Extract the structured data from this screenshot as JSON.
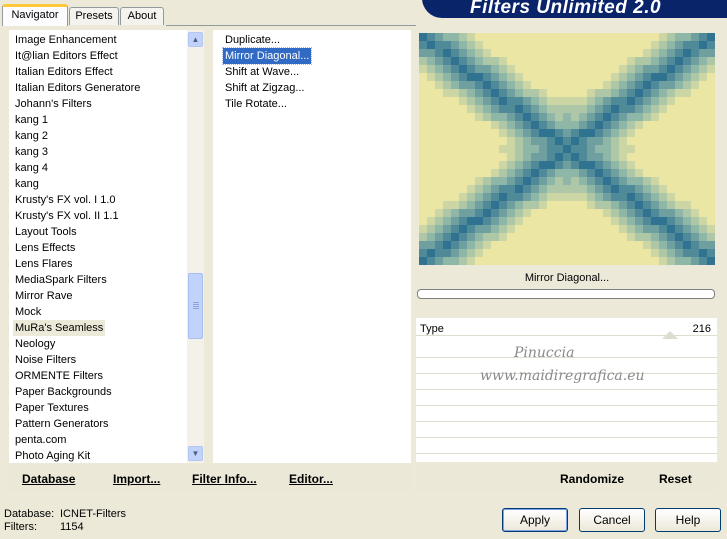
{
  "tabs": [
    {
      "label": "Navigator",
      "active": true
    },
    {
      "label": "Presets",
      "active": false
    },
    {
      "label": "About",
      "active": false
    }
  ],
  "app_title": "Filters Unlimited 2.0",
  "categories": [
    "Image Enhancement",
    "It@lian Editors Effect",
    "Italian Editors Effect",
    "Italian Editors Generatore",
    "Johann's Filters",
    "kang 1",
    "kang 2",
    "kang 3",
    "kang 4",
    "kang",
    "Krusty's FX vol. I 1.0",
    "Krusty's FX vol. II 1.1",
    "Layout Tools",
    "Lens Effects",
    "Lens Flares",
    "MediaSpark Filters",
    "Mirror Rave",
    "Mock",
    "MuRa's Seamless",
    "Neology",
    "Noise Filters",
    "ORMENTE Filters",
    "Paper Backgrounds",
    "Paper Textures",
    "Pattern Generators",
    "penta.com",
    "Photo Aging Kit"
  ],
  "selected_category": "MuRa's Seamless",
  "filters": [
    "Duplicate...",
    "Mirror Diagonal...",
    "Shift at Wave...",
    "Shift at Zigzag...",
    "Tile Rotate..."
  ],
  "selected_filter": "Mirror Diagonal...",
  "preview": {
    "filter_name": "Mirror Diagonal...",
    "colors": {
      "light": "#ebe6a4",
      "mid": "#8fb7a7",
      "dark": "#2f7390"
    }
  },
  "params": [
    {
      "label": "Type",
      "value": "216"
    }
  ],
  "watermark": {
    "line1": "Pinuccia",
    "line2": "www.maidiregrafica.eu"
  },
  "left_links": [
    "Database",
    "Import...",
    "Filter Info...",
    "Editor..."
  ],
  "right_links": [
    "Randomize",
    "Reset"
  ],
  "status": {
    "database_label": "Database:",
    "database_value": "ICNET-Filters",
    "filters_label": "Filters:",
    "filters_value": "1154"
  },
  "buttons": {
    "apply": "Apply",
    "cancel": "Cancel",
    "help": "Help"
  },
  "icons": {
    "scroll_up": "arrow-up-icon",
    "scroll_down": "arrow-down-icon"
  },
  "colors": {
    "banner": "#0a246a",
    "selection": "#316ac5",
    "tab_accent": "#ffc83c"
  }
}
